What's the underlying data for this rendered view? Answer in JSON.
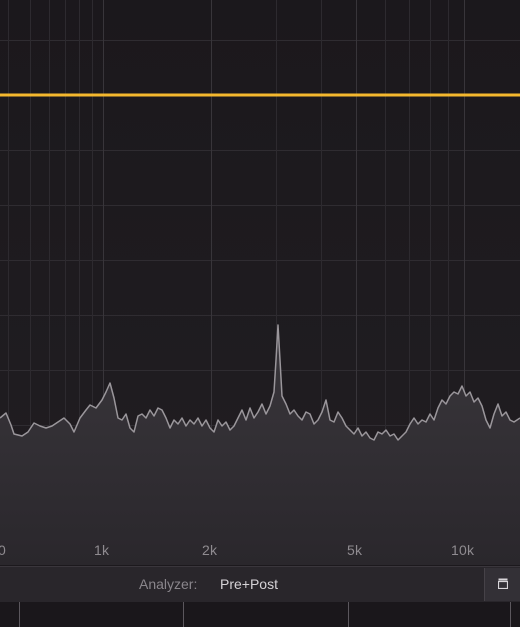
{
  "spectrum": {
    "freq_labels": [
      "0",
      "1k",
      "2k",
      "5k",
      "10k"
    ],
    "eq_curve_color": "#f5b82e",
    "analyzer_color": "#9a969b"
  },
  "bottom_bar": {
    "analyzer_label": "Analyzer:",
    "analyzer_value": "Pre+Post",
    "panel_toggle_icon": "panel-toggle-icon"
  }
}
